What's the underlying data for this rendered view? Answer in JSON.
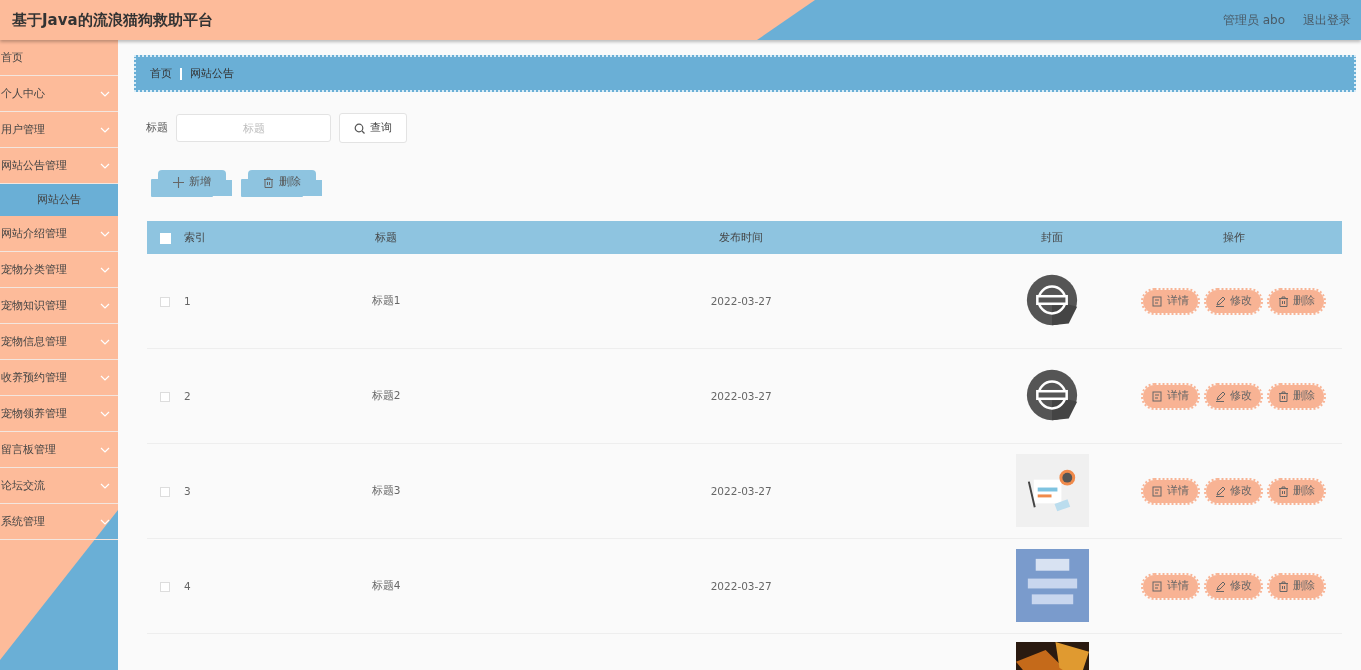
{
  "header": {
    "title": "基于Java的流浪猫狗救助平台",
    "user": "管理员 abo",
    "logout": "退出登录"
  },
  "sidebar": {
    "items": [
      {
        "label": "首页",
        "kind": "link"
      },
      {
        "label": "个人中心",
        "kind": "menu"
      },
      {
        "label": "用户管理",
        "kind": "menu"
      },
      {
        "label": "网站公告管理",
        "kind": "menu",
        "children": [
          {
            "label": "网站公告",
            "selected": true
          }
        ]
      },
      {
        "label": "网站介绍管理",
        "kind": "menu"
      },
      {
        "label": "宠物分类管理",
        "kind": "menu"
      },
      {
        "label": "宠物知识管理",
        "kind": "menu"
      },
      {
        "label": "宠物信息管理",
        "kind": "menu"
      },
      {
        "label": "收养预约管理",
        "kind": "menu"
      },
      {
        "label": "宠物领养管理",
        "kind": "menu"
      },
      {
        "label": "留言板管理",
        "kind": "menu"
      },
      {
        "label": "论坛交流",
        "kind": "menu"
      },
      {
        "label": "系统管理",
        "kind": "menu"
      }
    ]
  },
  "breadcrumb": [
    "首页",
    "网站公告"
  ],
  "search": {
    "label": "标题",
    "placeholder": "标题",
    "button": "查询"
  },
  "actions": [
    {
      "label": "新增",
      "kind": "add"
    },
    {
      "label": "删除",
      "kind": "delete"
    }
  ],
  "table": {
    "select_all": {
      "checked": false
    },
    "columns": [
      "索引",
      "标题",
      "发布时间",
      "封面",
      "操作"
    ],
    "rows": [
      {
        "kind": "full",
        "checked": false,
        "index": "1",
        "title": "标题1",
        "date": "2022-03-27",
        "buttons": [
          {
            "label": "详情",
            "kind": "detail"
          },
          {
            "label": "修改",
            "kind": "edit"
          },
          {
            "label": "删除",
            "kind": "delete"
          }
        ]
      },
      {
        "kind": "full",
        "checked": false,
        "index": "2",
        "title": "标题2",
        "date": "2022-03-27",
        "buttons": [
          {
            "label": "详情",
            "kind": "detail"
          },
          {
            "label": "修改",
            "kind": "edit"
          },
          {
            "label": "删除",
            "kind": "delete"
          }
        ]
      },
      {
        "kind": "full",
        "checked": false,
        "index": "3",
        "title": "标题3",
        "date": "2022-03-27",
        "buttons": [
          {
            "label": "详情",
            "kind": "detail"
          },
          {
            "label": "修改",
            "kind": "edit"
          },
          {
            "label": "删除",
            "kind": "delete"
          }
        ]
      },
      {
        "kind": "full",
        "checked": false,
        "index": "4",
        "title": "标题4",
        "date": "2022-03-27",
        "buttons": [
          {
            "label": "详情",
            "kind": "detail"
          },
          {
            "label": "修改",
            "kind": "edit"
          },
          {
            "label": "删除",
            "kind": "delete"
          }
        ]
      },
      {
        "kind": "partial"
      }
    ]
  }
}
